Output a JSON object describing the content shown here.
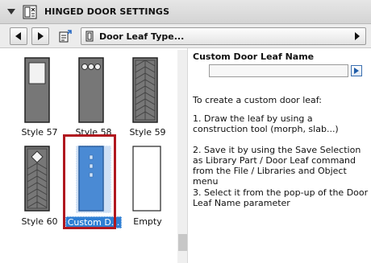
{
  "panel": {
    "title": "HINGED DOOR SETTINGS",
    "title_icon": "door-settings-icon"
  },
  "toolbar": {
    "prev_icon": "arrow-left-icon",
    "next_icon": "arrow-right-icon",
    "settings_icon": "page-settings-icon",
    "page_icon": "door-leaf-icon",
    "page_selector": "Door Leaf Type..."
  },
  "gallery": {
    "selected_index": 4,
    "selection_color": "#b0171f",
    "items": [
      {
        "label": "Style 57",
        "icon": "door-glass-panel-icon"
      },
      {
        "label": "Style 58",
        "icon": "door-three-circles-icon"
      },
      {
        "label": "Style 59",
        "icon": "door-herringbone-icon"
      },
      {
        "label": "Style 60",
        "icon": "door-diamond-herringbone-icon"
      },
      {
        "label": "Custom D...",
        "icon": "door-custom-icon"
      },
      {
        "label": "Empty",
        "icon": "door-empty-icon"
      }
    ]
  },
  "details": {
    "field_label": "Custom Door Leaf Name",
    "field_value": "",
    "intro": "To create a custom door leaf:",
    "step1": "1. Draw the leaf by using a construction tool (morph, slab...)",
    "step2": "2. Save it by using the Save Selection as Library Part / Door Leaf command from the File / Libraries and Object menu",
    "step3": "3. Select it from the pop-up of the Door Leaf Name parameter"
  },
  "colors": {
    "header_bg": "#d9d9d9",
    "door_gray": "#7a7a7a",
    "custom_blue": "#4a8ad4",
    "selection_blue": "#2f7fd4"
  }
}
